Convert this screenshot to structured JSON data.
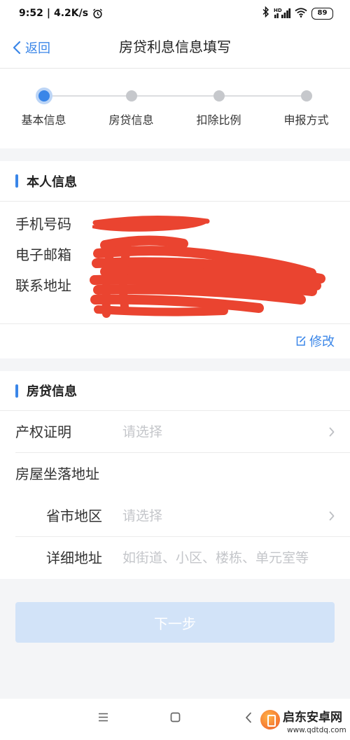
{
  "status_bar": {
    "time": "9:52",
    "separator": "|",
    "net_speed": "4.2K/s",
    "signal_label": "HD",
    "battery": "89",
    "icons": [
      "alarm-icon",
      "bluetooth-icon",
      "signal-icon",
      "wifi-icon",
      "battery-icon"
    ]
  },
  "header": {
    "back_label": "返回",
    "back_icon": "chevron-left-icon",
    "title": "房贷利息信息填写"
  },
  "steps": {
    "current": 1,
    "items": [
      {
        "label": "基本信息"
      },
      {
        "label": "房贷信息"
      },
      {
        "label": "扣除比例"
      },
      {
        "label": "申报方式"
      }
    ]
  },
  "personal_section": {
    "title": "本人信息",
    "fields": [
      {
        "label": "手机号码"
      },
      {
        "label": "电子邮箱"
      },
      {
        "label": "联系地址"
      }
    ],
    "edit_label": "修改",
    "edit_icon": "edit-icon"
  },
  "loan_section": {
    "title": "房贷信息",
    "rows": [
      {
        "label": "产权证明",
        "placeholder": "请选择",
        "has_chevron": true
      },
      {
        "label": "房屋坐落地址"
      },
      {
        "label": "省市地区",
        "placeholder": "请选择",
        "has_chevron": true
      },
      {
        "label": "详细地址",
        "placeholder": "如街道、小区、楼栋、单元室等",
        "value": ""
      }
    ]
  },
  "next_button": {
    "label": "下一步",
    "enabled": false
  },
  "nav_bar": {
    "icons": [
      "menu-icon",
      "home-square-icon",
      "back-icon"
    ]
  },
  "watermark": {
    "name": "启东安卓网",
    "url": "www.qdtdq.com"
  },
  "colors": {
    "accent": "#3a86e8",
    "placeholder": "#c4c6ca",
    "background": "#f4f5f7",
    "button_disabled": "#d2e3f8",
    "redaction": "#ea4430"
  }
}
